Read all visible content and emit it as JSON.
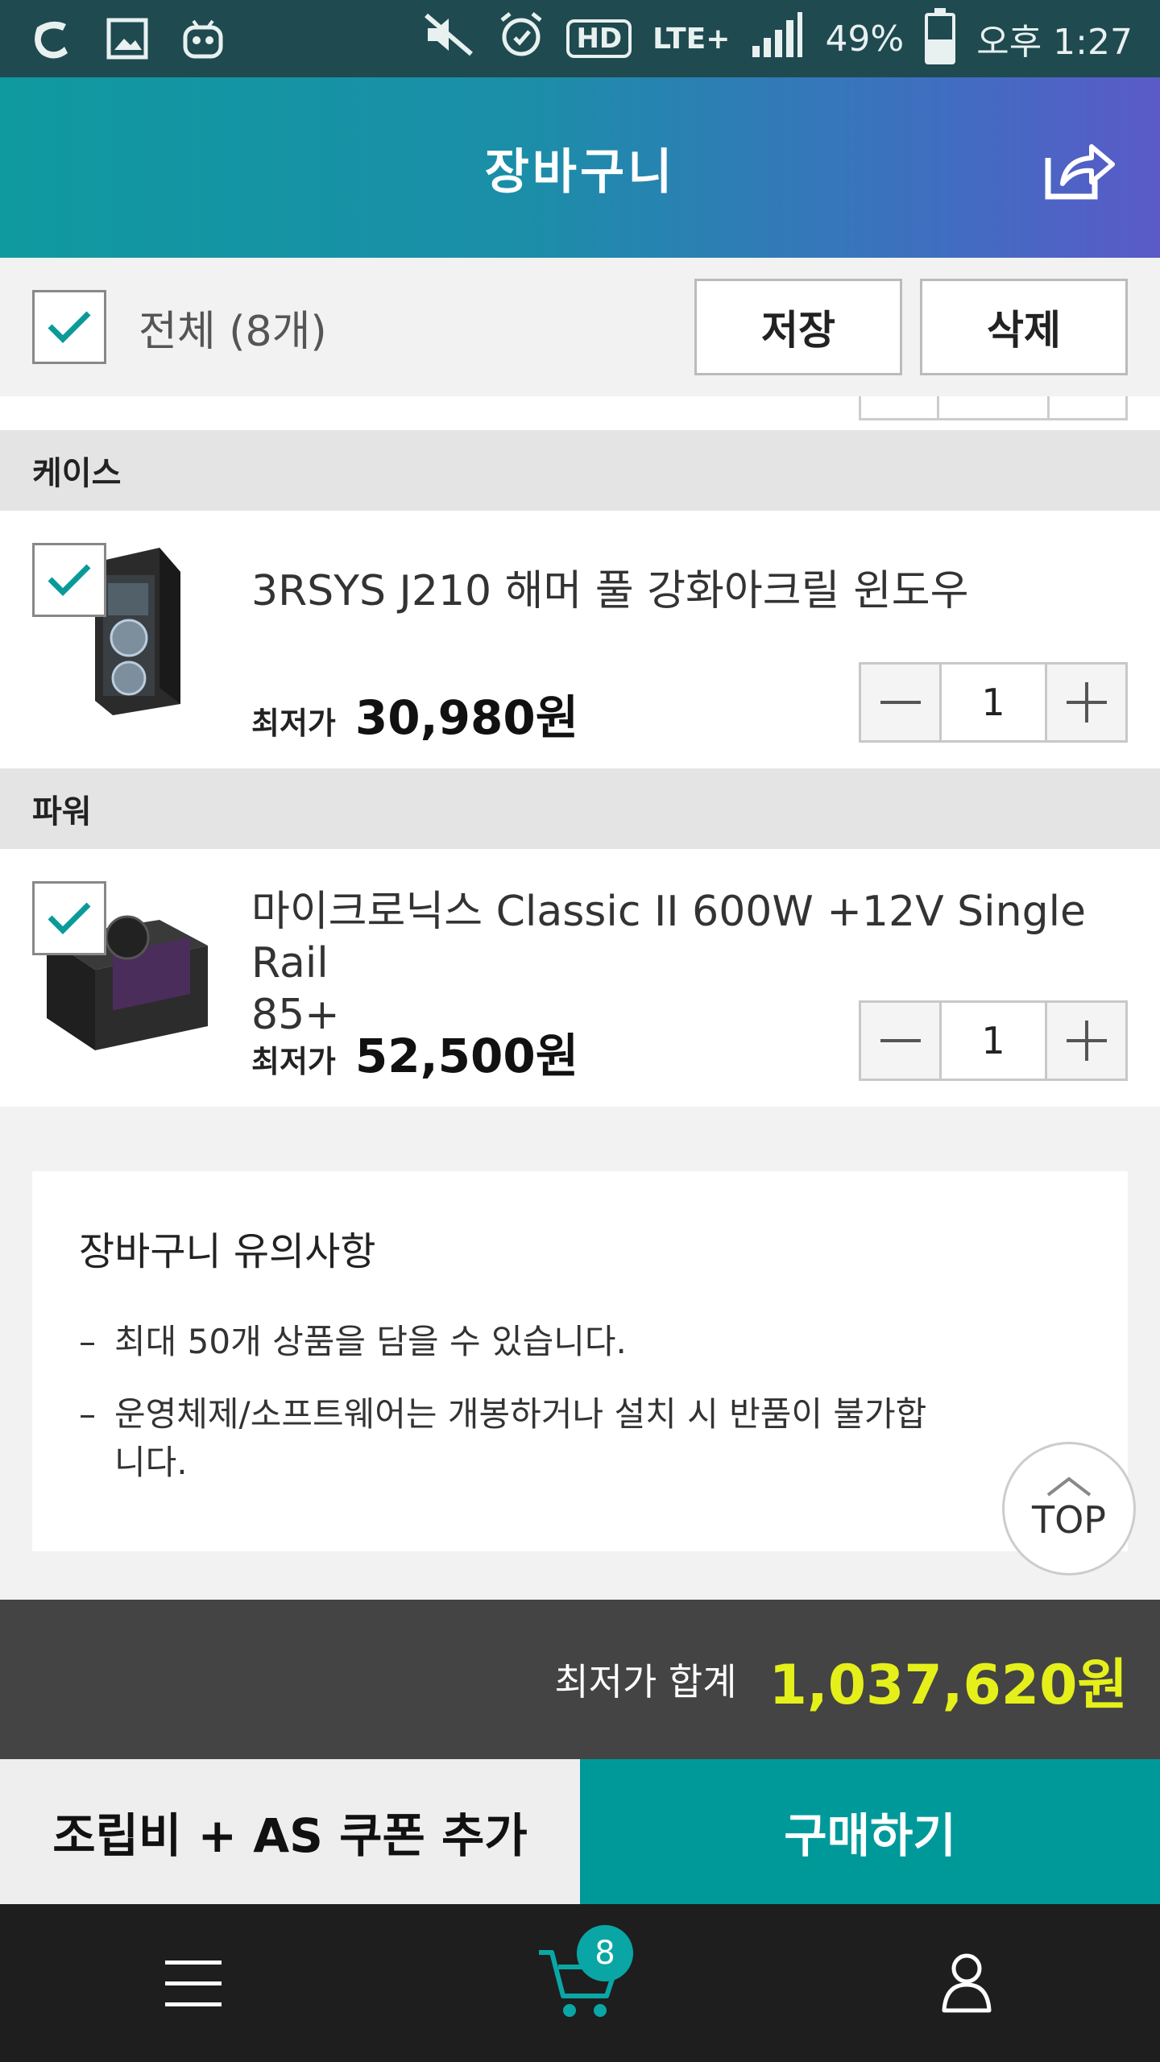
{
  "status_bar": {
    "mute_label": "",
    "network_hd": "HD",
    "network_lte": "LTE+",
    "battery_percent": "49%",
    "battery_level": 0.49,
    "time": "오후 1:27"
  },
  "header": {
    "title": "장바구니",
    "share_icon": "share-icon"
  },
  "toolbar": {
    "select_all_label": "전체 (8개)",
    "select_all_checked": true,
    "save_label": "저장",
    "delete_label": "삭제"
  },
  "categories": [
    {
      "name": "케이스",
      "items": [
        {
          "name": "3RSYS J210 해머 풀 강화아크릴 윈도우",
          "price_label": "최저가",
          "price": "30,980원",
          "quantity": "1",
          "checked": true
        }
      ]
    },
    {
      "name": "파워",
      "items": [
        {
          "name_line1": "마이크로닉스 Classic II 600W +12V Single Rail",
          "name_line2": "85+",
          "price_label": "최저가",
          "price": "52,500원",
          "quantity": "1",
          "checked": true
        }
      ]
    }
  ],
  "notice": {
    "title": "장바구니 유의사항",
    "lines": [
      "최대 50개 상품을 담을 수 있습니다.",
      "운영체제/소프트웨어는 개봉하거나 설치 시 반품이 불가합니다."
    ],
    "dash": "–"
  },
  "top_button": {
    "label": "TOP"
  },
  "total": {
    "label": "최저가 합계",
    "value": "1,037,620원"
  },
  "actions": {
    "coupon_label": "조립비 + AS 쿠폰 추가",
    "buy_label": "구매하기"
  },
  "bottom_nav": {
    "cart_count": "8"
  },
  "colors": {
    "accent": "#00999a",
    "total_value": "#e5f01a",
    "header_start": "#0f9aa0",
    "header_end": "#5a5ac8"
  }
}
